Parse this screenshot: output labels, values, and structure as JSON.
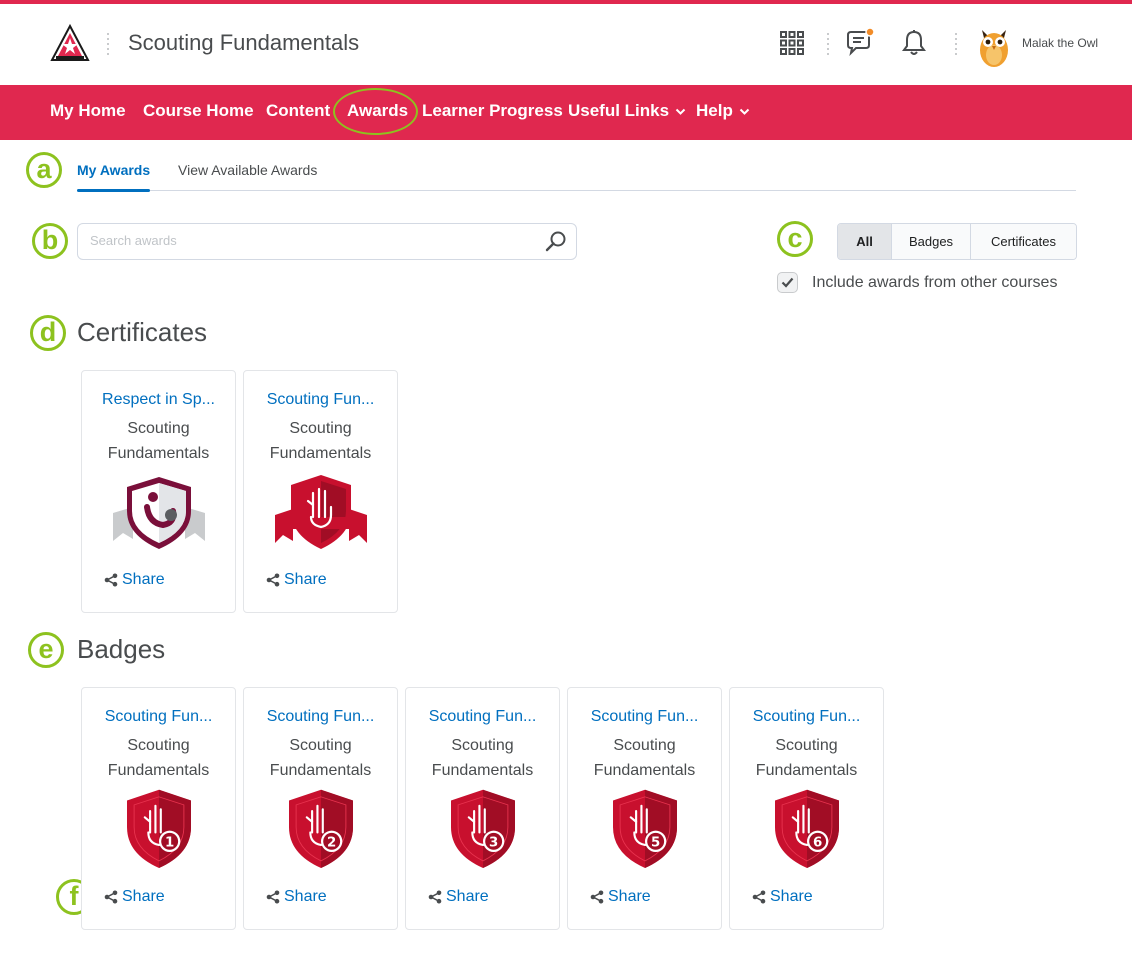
{
  "header": {
    "title": "Scouting Fundamentals",
    "user_name": "Malak the Owl",
    "icons": [
      "waffle-icon",
      "message-icon",
      "bell-icon"
    ],
    "notification_dot_color": "#f28c28"
  },
  "nav": {
    "items": [
      "My Home",
      "Course Home",
      "Content",
      "Awards",
      "Learner Progress",
      "Useful Links",
      "Help"
    ],
    "color": "#e0284f"
  },
  "callouts": [
    "a",
    "b",
    "c",
    "d",
    "e",
    "f"
  ],
  "tabs": {
    "my_awards": "My Awards",
    "view_available": "View Available Awards"
  },
  "search": {
    "placeholder": "Search awards"
  },
  "filter": {
    "all": "All",
    "badges": "Badges",
    "certificates": "Certificates"
  },
  "include_label": "Include awards from other courses",
  "include_checked": true,
  "sections": {
    "certificates": "Certificates",
    "badges": "Badges"
  },
  "share_label": "Share",
  "certificates": [
    {
      "title": "Respect in Sp...",
      "course_line1": "Scouting",
      "course_line2": "Fundamentals",
      "icon": "respect-in-sport-certificate"
    },
    {
      "title": "Scouting Fun...",
      "course_line1": "Scouting",
      "course_line2": "Fundamentals",
      "icon": "scout-salute-certificate"
    }
  ],
  "badges": [
    {
      "title": "Scouting Fun...",
      "course_line1": "Scouting",
      "course_line2": "Fundamentals",
      "number": "1"
    },
    {
      "title": "Scouting Fun...",
      "course_line1": "Scouting",
      "course_line2": "Fundamentals",
      "number": "2"
    },
    {
      "title": "Scouting Fun...",
      "course_line1": "Scouting",
      "course_line2": "Fundamentals",
      "number": "3"
    },
    {
      "title": "Scouting Fun...",
      "course_line1": "Scouting",
      "course_line2": "Fundamentals",
      "number": "5"
    },
    {
      "title": "Scouting Fun...",
      "course_line1": "Scouting",
      "course_line2": "Fundamentals",
      "number": "6"
    }
  ],
  "colors": {
    "accent": "#006fbf",
    "callout": "#8dc21f",
    "badge_red": "#c8102e",
    "certificate_maroon": "#7a0f3a"
  }
}
